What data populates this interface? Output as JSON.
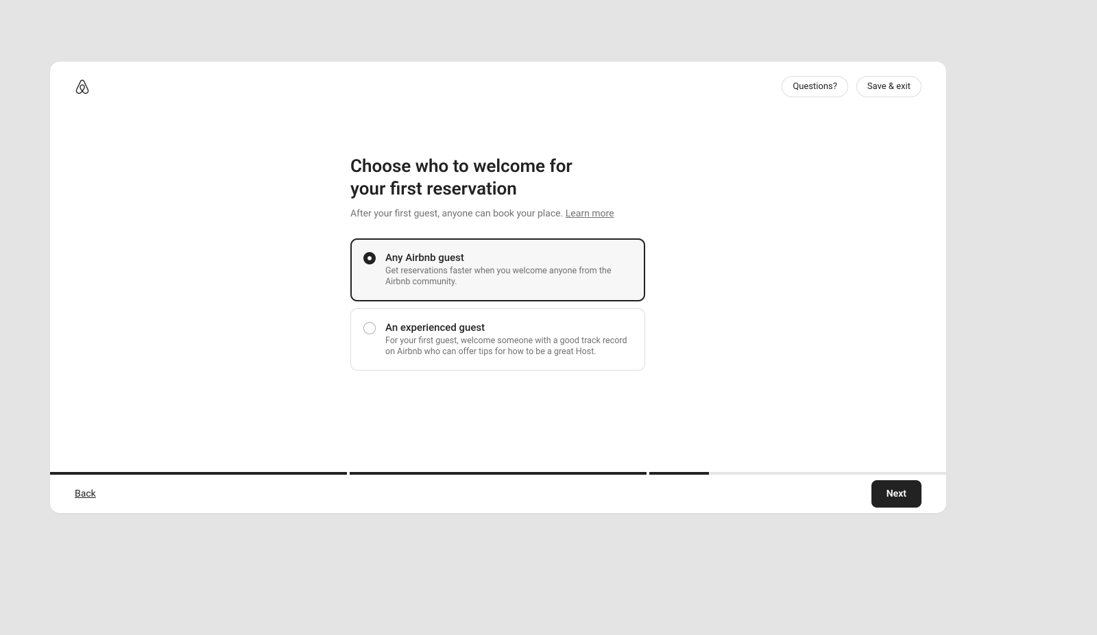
{
  "header": {
    "questions_label": "Questions?",
    "save_exit_label": "Save & exit"
  },
  "main": {
    "title": "Choose who to welcome for your first reservation",
    "subtitle_text": "After your first guest, anyone can book your place. ",
    "subtitle_link": "Learn more",
    "options": [
      {
        "title": "Any Airbnb guest",
        "description": "Get reservations faster when you welcome anyone from the Airbnb community.",
        "selected": true
      },
      {
        "title": "An experienced guest",
        "description": "For your first guest, welcome someone with a good track record on Airbnb who can offer tips for how to be a great Host.",
        "selected": false
      }
    ]
  },
  "progress": {
    "segments": [
      100,
      100,
      20
    ]
  },
  "footer": {
    "back_label": "Back",
    "next_label": "Next"
  }
}
